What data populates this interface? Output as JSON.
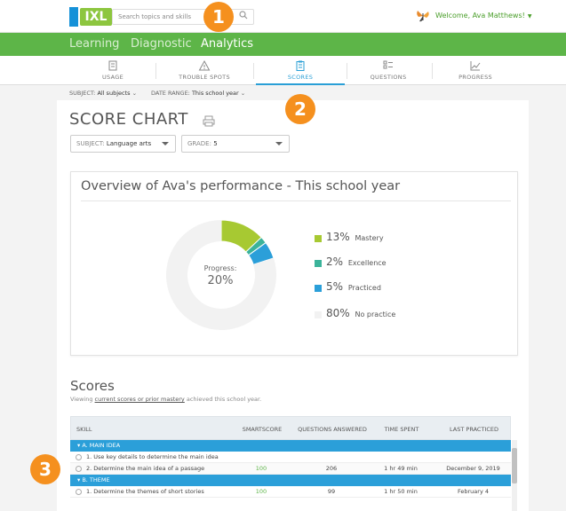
{
  "header": {
    "logo_text": "IXL",
    "search_placeholder": "Search topics and skills",
    "welcome": "Welcome, Ava Matthews!"
  },
  "nav": {
    "tabs": [
      {
        "label": "Learning"
      },
      {
        "label": "Diagnostic"
      },
      {
        "label": "Analytics"
      }
    ],
    "active": "Analytics"
  },
  "subtabs": [
    {
      "label": "USAGE",
      "icon": "usage-icon"
    },
    {
      "label": "TROUBLE SPOTS",
      "icon": "warning-icon"
    },
    {
      "label": "SCORES",
      "icon": "clipboard-icon"
    },
    {
      "label": "QUESTIONS",
      "icon": "list-icon"
    },
    {
      "label": "PROGRESS",
      "icon": "chart-icon"
    }
  ],
  "filters": {
    "subject_label": "SUBJECT:",
    "subject_value": "All subjects",
    "range_label": "DATE RANGE:",
    "range_value": "This school year"
  },
  "page": {
    "title": "SCORE CHART",
    "subject_label": "SUBJECT:",
    "subject_value": "Language arts",
    "grade_label": "GRADE:",
    "grade_value": "5"
  },
  "overview": {
    "title": "Overview of Ava's performance - This school year",
    "progress_label": "Progress:",
    "progress_value": "20%",
    "legend": [
      {
        "pct": "13%",
        "name": "Mastery",
        "value": 13,
        "color": "#a7c932"
      },
      {
        "pct": "2%",
        "name": "Excellence",
        "value": 2,
        "color": "#3bb39a"
      },
      {
        "pct": "5%",
        "name": "Practiced",
        "value": 5,
        "color": "#2b9fd9"
      },
      {
        "pct": "80%",
        "name": "No practice",
        "value": 80,
        "color": "#f2f2f2"
      }
    ]
  },
  "scores": {
    "title": "Scores",
    "sub_prefix": "Viewing ",
    "sub_link": "current scores or prior mastery",
    "sub_suffix": " achieved this school year.",
    "headers": {
      "skill": "SKILL",
      "smartscore": "SMARTSCORE",
      "questions": "QUESTIONS ANSWERED",
      "time": "TIME SPENT",
      "last": "LAST PRACTICED"
    },
    "sections": [
      {
        "name": "▾  A. MAIN IDEA",
        "rows": [
          {
            "skill": "1. Use key details to determine the main idea",
            "smartscore": "",
            "questions": "",
            "time": "",
            "last": ""
          },
          {
            "skill": "2. Determine the main idea of a passage",
            "smartscore": "100",
            "questions": "206",
            "time": "1 hr 49 min",
            "last": "December 9, 2019"
          }
        ]
      },
      {
        "name": "▾  B. THEME",
        "rows": [
          {
            "skill": "1. Determine the themes of short stories",
            "smartscore": "100",
            "questions": "99",
            "time": "1 hr 50 min",
            "last": "February 4"
          }
        ]
      }
    ]
  },
  "steps": [
    "1",
    "2",
    "3"
  ]
}
